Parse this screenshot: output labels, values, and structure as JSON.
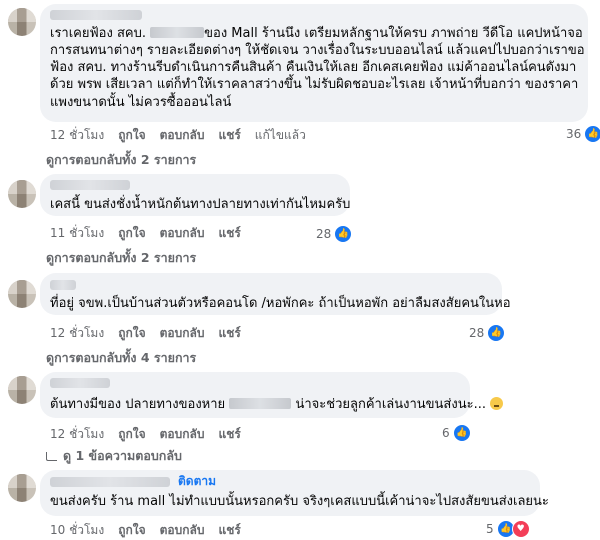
{
  "comments": [
    {
      "lines": [
        "เราเคยฟ้อง สคบ. [blur]ของ Mall ร้านนึง เตรียมหลักฐานให้ครบ ภาพถ่าย วีดีโอ แคปหน้าจอ",
        "การสนทนาต่างๆ รายละเอียดต่างๆ ให้ชัดเจน วางเรื่องในระบบออนไลน์ แล้วแคปไปบอกว่าเราขอ",
        "ฟ้อง สคบ. ทางร้านรีบดำเนินการคืนสินค้า คืนเงินให้เลย อีกเคสเคยฟ้อง แม่ค้าออนไลน์คนดังมา",
        "ด้วย พรพ เสียเวลา แต่ก็ทำให้เราคลาสว่างขึ้น ไม่รับผิดชอบอะไรเลย เจ้าหน้าที่บอกว่า ของราคา",
        "แพงขนาดนั้น ไม่ควรซื้อออนไลน์"
      ],
      "time": "12 ชั่วโมง",
      "like": "ถูกใจ",
      "reply": "ตอบกลับ",
      "share": "แชร์",
      "edited": "แก้ไขแล้ว",
      "reaction_count": "36",
      "replies_link": "ดูการตอบกลับทั้ง 2 รายการ"
    },
    {
      "lines": [
        "เคสนี้ ขนส่งชั่งน้ำหนักต้นทางปลายทางเท่ากันไหมครับ"
      ],
      "time": "11 ชั่วโมง",
      "like": "ถูกใจ",
      "reply": "ตอบกลับ",
      "share": "แชร์",
      "reaction_count": "28",
      "replies_link": "ดูการตอบกลับทั้ง 2 รายการ"
    },
    {
      "lines": [
        "ที่อยู่ จขพ.เป็นบ้านส่วนตัวหรือคอนโด /หอพักคะ ถ้าเป็นหอพัก อย่าลืมสงสัยคนในหอ"
      ],
      "time": "12 ชั่วโมง",
      "like": "ถูกใจ",
      "reply": "ตอบกลับ",
      "share": "แชร์",
      "reaction_count": "28",
      "replies_link": "ดูการตอบกลับทั้ง 4 รายการ"
    },
    {
      "lines": [
        "ต้นทางมีของ ปลายทางของหาย",
        "น่าจะช่วยลูกค้าเล่นงานขนส่งนะ..."
      ],
      "time": "12 ชั่วโมง",
      "like": "ถูกใจ",
      "reply": "ตอบกลับ",
      "share": "แชร์",
      "reaction_count": "6",
      "replies_link": "ดู 1 ข้อความตอบกลับ"
    },
    {
      "follow": "ติดตาม",
      "lines": [
        "ขนส่งครับ ร้าน mall ไม่ทำแบบนั้นหรอกครับ จริงๆเคสแบบนี้เค้าน่าจะไปสงสัยขนส่งเลยนะ"
      ],
      "time": "10 ชั่วโมง",
      "like": "ถูกใจ",
      "reply": "ตอบกลับ",
      "share": "แชร์",
      "reaction_count": "5"
    }
  ],
  "icons": {
    "like": "like-icon",
    "love": "love-icon",
    "reply": "reply-arrow-icon",
    "emoji": "sad-emoji-icon"
  },
  "colors": {
    "bubble": "#f0f2f5",
    "secondary_text": "#65676b",
    "accent": "#1877f2"
  }
}
